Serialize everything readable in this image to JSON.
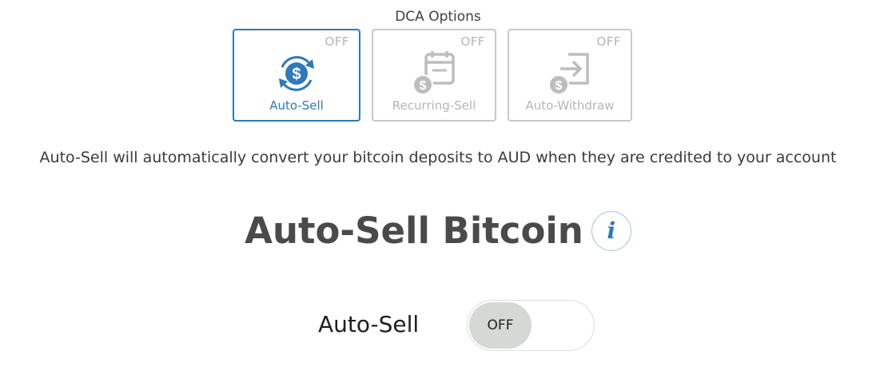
{
  "dca": {
    "title": "DCA Options",
    "options": [
      {
        "label": "Auto-Sell",
        "state": "OFF",
        "active": true,
        "icon": "dollar-cycle-icon"
      },
      {
        "label": "Recurring-Sell",
        "state": "OFF",
        "active": false,
        "icon": "calendar-dollar-icon"
      },
      {
        "label": "Auto-Withdraw",
        "state": "OFF",
        "active": false,
        "icon": "withdraw-dollar-icon"
      }
    ]
  },
  "description": "Auto-Sell will automatically convert your bitcoin deposits to AUD when they are credited to your account",
  "heading": "Auto-Sell Bitcoin",
  "info_icon": "i",
  "toggle": {
    "label": "Auto-Sell",
    "state": "OFF"
  },
  "colors": {
    "accent": "#2f79b8",
    "inactive": "#b6b6b6",
    "knob": "#d5d9d5"
  }
}
